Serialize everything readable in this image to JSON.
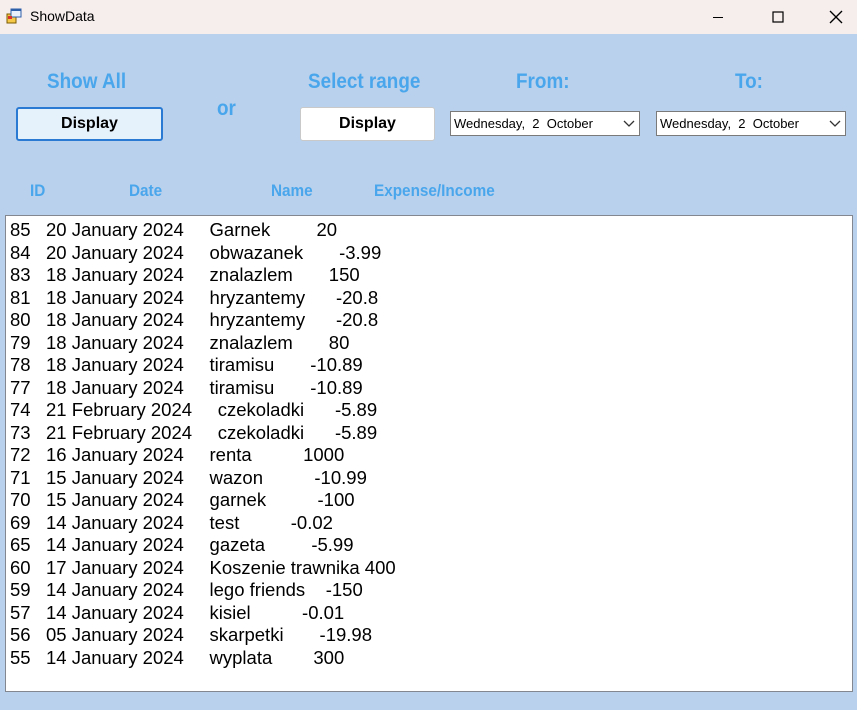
{
  "window": {
    "title": "ShowData"
  },
  "header": {
    "show_all": "Show All",
    "or": "or",
    "select_range": "Select range",
    "from": "From:",
    "to": "To:",
    "display_all_label": "Display",
    "display_range_label": "Display",
    "from_date": "Wednesday,  2  October",
    "to_date": "Wednesday,  2  October"
  },
  "columns": {
    "id": "ID",
    "date": "Date",
    "name": "Name",
    "amount": "Expense/Income"
  },
  "list": {
    "rows": [
      "85   20 January 2024     Garnek         20",
      "84   20 January 2024     obwazanek       -3.99",
      "83   18 January 2024     znalazlem       150",
      "81   18 January 2024     hryzantemy      -20.8",
      "80   18 January 2024     hryzantemy      -20.8",
      "79   18 January 2024     znalazlem       80",
      "78   18 January 2024     tiramisu       -10.89",
      "77   18 January 2024     tiramisu       -10.89",
      "74   21 February 2024     czekoladki      -5.89",
      "73   21 February 2024     czekoladki      -5.89",
      "72   16 January 2024     renta          1000",
      "71   15 January 2024     wazon          -10.99",
      "70   15 January 2024     garnek          -100",
      "69   14 January 2024     test          -0.02",
      "65   14 January 2024     gazeta         -5.99",
      "60   17 January 2024     Koszenie trawnika 400",
      "59   14 January 2024     lego friends    -150",
      "57   14 January 2024     kisiel          -0.01",
      "56   05 January 2024     skarpetki       -19.98",
      "55   14 January 2024     wyplata        300"
    ]
  }
}
